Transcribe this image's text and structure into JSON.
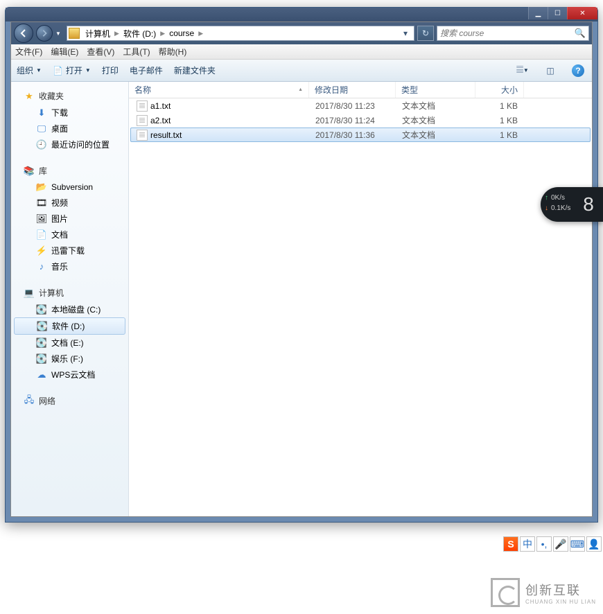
{
  "breadcrumb": {
    "p0": "计算机",
    "p1": "软件 (D:)",
    "p2": "course"
  },
  "search": {
    "placeholder": "搜索 course"
  },
  "menu": {
    "file": "文件(F)",
    "edit": "编辑(E)",
    "view": "查看(V)",
    "tools": "工具(T)",
    "help": "帮助(H)"
  },
  "toolbar": {
    "organize": "组织",
    "open": "打开",
    "print": "打印",
    "email": "电子邮件",
    "newfolder": "新建文件夹"
  },
  "columns": {
    "name": "名称",
    "date": "修改日期",
    "type": "类型",
    "size": "大小"
  },
  "files": [
    {
      "name": "a1.txt",
      "date": "2017/8/30 11:23",
      "type": "文本文档",
      "size": "1 KB",
      "sel": false
    },
    {
      "name": "a2.txt",
      "date": "2017/8/30 11:24",
      "type": "文本文档",
      "size": "1 KB",
      "sel": false
    },
    {
      "name": "result.txt",
      "date": "2017/8/30 11:36",
      "type": "文本文档",
      "size": "1 KB",
      "sel": true
    }
  ],
  "sidebar": {
    "fav": {
      "title": "收藏夹",
      "download": "下载",
      "desktop": "桌面",
      "recent": "最近访问的位置"
    },
    "lib": {
      "title": "库",
      "svn": "Subversion",
      "video": "视频",
      "pic": "图片",
      "doc": "文档",
      "thunder": "迅雷下载",
      "music": "音乐"
    },
    "comp": {
      "title": "计算机",
      "c": "本地磁盘 (C:)",
      "d": "软件 (D:)",
      "e": "文档 (E:)",
      "f": "娱乐 (F:)",
      "wps": "WPS云文档"
    },
    "net": {
      "title": "网络"
    }
  },
  "netwidget": {
    "up": "0K/s",
    "down": "0.1K/s",
    "num": "8"
  },
  "ime": {
    "lang": "中",
    "logo": "S"
  },
  "footer": {
    "brand": "创新互联",
    "sub": "CHUANG XIN HU LIAN"
  }
}
